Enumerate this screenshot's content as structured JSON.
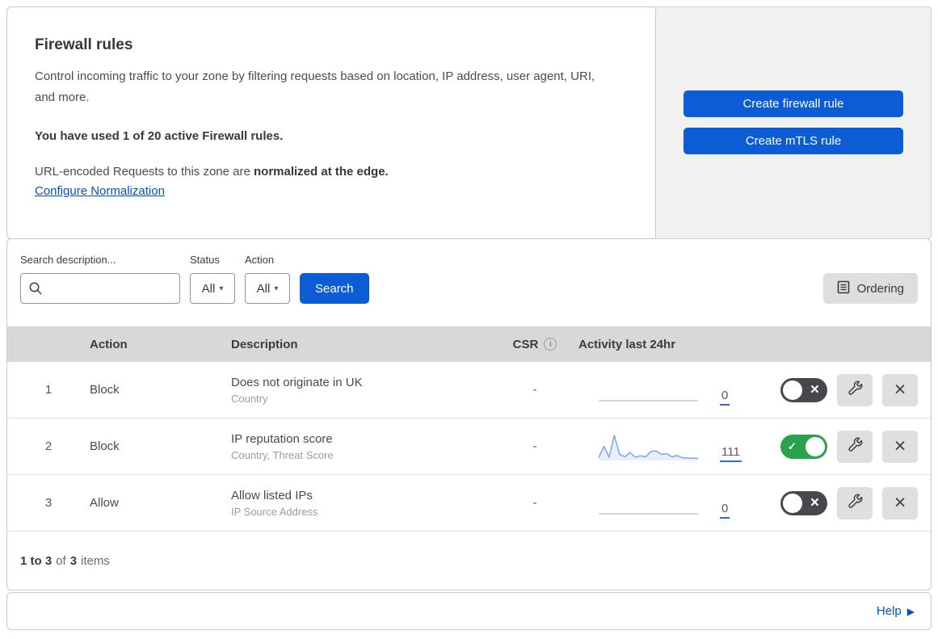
{
  "header": {
    "title": "Firewall rules",
    "description": "Control incoming traffic to your zone by filtering requests based on location, IP address, user agent, URI, and more.",
    "usage_line": "You have used 1 of 20 active Firewall rules.",
    "normalization_text": "URL-encoded Requests to this zone are",
    "normalization_bold": "normalized at the edge.",
    "normalization_link": "Configure Normalization",
    "create_firewall_button": "Create firewall rule",
    "create_mtls_button": "Create mTLS rule"
  },
  "filters": {
    "search_label": "Search description...",
    "search_value": "",
    "status_label": "Status",
    "status_value": "All",
    "action_label": "Action",
    "action_value": "All",
    "search_button": "Search",
    "ordering_button": "Ordering"
  },
  "table": {
    "columns": {
      "action": "Action",
      "description": "Description",
      "csr": "CSR",
      "activity": "Activity last 24hr"
    },
    "rows": [
      {
        "number": "1",
        "action": "Block",
        "description": "Does not originate in UK",
        "fields": "Country",
        "csr": "-",
        "activity_count": "0",
        "enabled": false,
        "sparkline": []
      },
      {
        "number": "2",
        "action": "Block",
        "description": "IP reputation score",
        "fields": "Country, Threat Score",
        "csr": "-",
        "activity_count": "111",
        "enabled": true,
        "sparkline": [
          8,
          55,
          10,
          100,
          22,
          12,
          30,
          10,
          16,
          12,
          34,
          36,
          22,
          25,
          12,
          17,
          8,
          7,
          6,
          6
        ]
      },
      {
        "number": "3",
        "action": "Allow",
        "description": "Allow listed IPs",
        "fields": "IP Source Address",
        "csr": "-",
        "activity_count": "0",
        "enabled": false,
        "sparkline": []
      }
    ]
  },
  "footer": {
    "range": "1 to 3",
    "of": "of",
    "total": "3",
    "items": "items"
  },
  "help": {
    "label": "Help"
  },
  "colors": {
    "primary_blue": "#0b5cd5",
    "link_blue": "#0051c3",
    "toggle_on_green": "#28a24b",
    "toggle_off_gray": "#47484d",
    "spark_blue": "#7da7e8",
    "table_header_gray": "#d8d8d8"
  }
}
